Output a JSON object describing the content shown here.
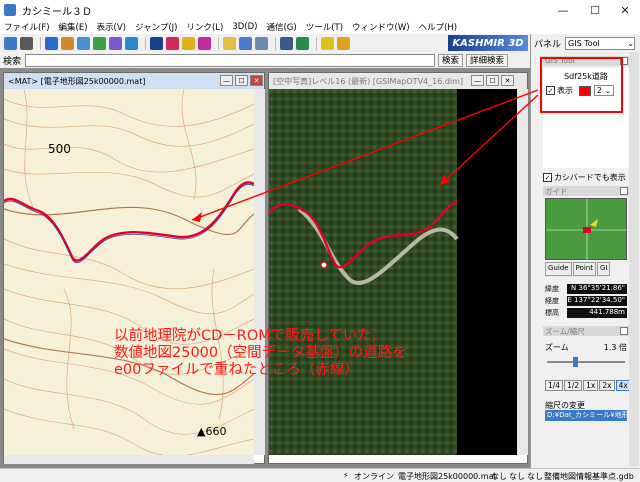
{
  "window": {
    "title": "カシミール３Ｄ",
    "minimize": "—",
    "maximize": "☐",
    "close": "✕"
  },
  "menu": [
    "ファイル(F)",
    "編集(E)",
    "表示(V)",
    "ジャンプ(J)",
    "リンク(L)",
    "3D(D)",
    "通信(G)",
    "ツール(T)",
    "ウィンドウ(W)",
    "ヘルプ(H)"
  ],
  "logo": "KASHMIR 3D",
  "search": {
    "label": "検索",
    "value": "",
    "button_search": "検索",
    "button_detail": "詳細検索"
  },
  "map_window": {
    "title": "<MAT> [電子地形図25k00000.mat]",
    "elev_label_1": "500",
    "elev_label_2": "▲660"
  },
  "sat_window": {
    "title": "[空中写真]レベル16 (最新) [GSIMapOTV4_16.dim]"
  },
  "panel": {
    "label": "パネル",
    "selected_tool": "GIS Tool",
    "gis_section": "GIS Tool",
    "layer_name": "Sdf25k道路",
    "display_label": "表示",
    "display_checked": "✓",
    "line_width": "2",
    "cashbird_label": "カシバードでも表示",
    "cashbird_checked": "✓",
    "guide_section": "ガイド",
    "guide_tabs": [
      "Guide",
      "Point",
      "GI"
    ],
    "coords": [
      {
        "label": "緯度",
        "value": "N 36°35'21.86\""
      },
      {
        "label": "経度",
        "value": "E 137°22'34.50\""
      },
      {
        "label": "標高",
        "value": "441.788m"
      }
    ],
    "zoom_section": "ズーム/縮尺",
    "zoom_label": "ズーム",
    "zoom_value": "1.3 倍",
    "zoom_buttons": [
      "1/4",
      "1/2",
      "1x",
      "2x",
      "4x"
    ],
    "scale_change_label": "縮尺の変更",
    "scale_path": "D:¥Dat_カシミール¥地形"
  },
  "status": {
    "online": "オンライン",
    "file": "電子地形図25k00000.mat",
    "none1": "なし",
    "none2": "なし",
    "none3": "なし",
    "gdb": "整備地図情報基準点.gdb"
  },
  "annotation": {
    "line1": "以前地理院がCD－ROMで販売していた,",
    "line2": "数値地図25000（空間データ基盤）の道路を",
    "line3": "e00ファイルで重ねたところ（赤線）"
  },
  "colors": {
    "road": "#e0002a",
    "annotation": "#ff1a1a",
    "guide_map": "#4a9a40"
  }
}
